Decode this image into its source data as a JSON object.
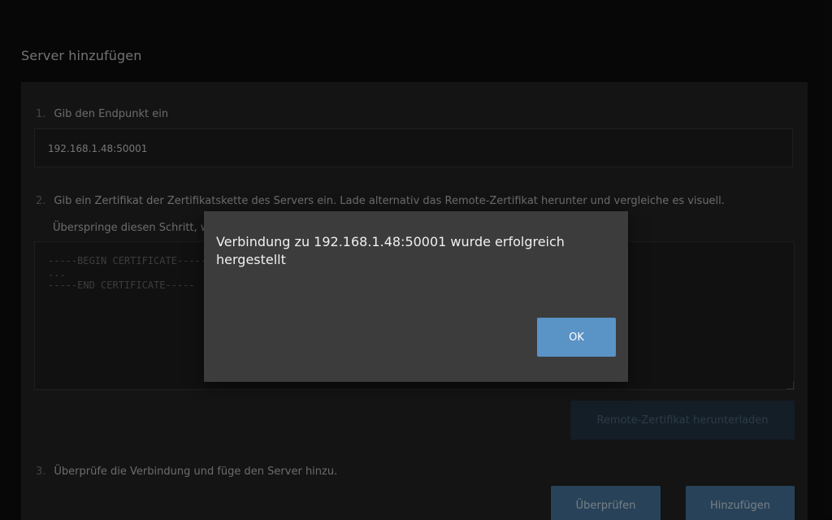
{
  "page": {
    "title": "Server hinzufügen"
  },
  "steps": {
    "step1": {
      "number": "1.",
      "label": "Gib den Endpunkt ein",
      "endpoint_value": "192.168.1.48:50001"
    },
    "step2": {
      "number": "2.",
      "label": "Gib ein Zertifikat der Zertifikatskette des Servers ein. Lade alternativ das Remote-Zertifikat herunter und vergleiche es visuell.",
      "sub_label_visible": "Überspringe diesen Schritt, we",
      "certificate_placeholder": "-----BEGIN CERTIFICATE-----\n...\n-----END CERTIFICATE-----",
      "download_button": "Remote-Zertifikat herunterladen"
    },
    "step3": {
      "number": "3.",
      "label": "Überprüfe die Verbindung und füge den Server hinzu.",
      "check_button": "Überprüfen",
      "add_button": "Hinzufügen"
    }
  },
  "dialog": {
    "message": "Verbindung zu 192.168.1.48:50001 wurde erfolgreich hergestellt",
    "ok_label": "OK"
  },
  "colors": {
    "background": "#0e0e0e",
    "panel": "#252525",
    "dialog": "#3c3c3c",
    "primary_button": "#4a7aa3",
    "dialog_button": "#5a93c6",
    "disabled_button": "#263847"
  }
}
